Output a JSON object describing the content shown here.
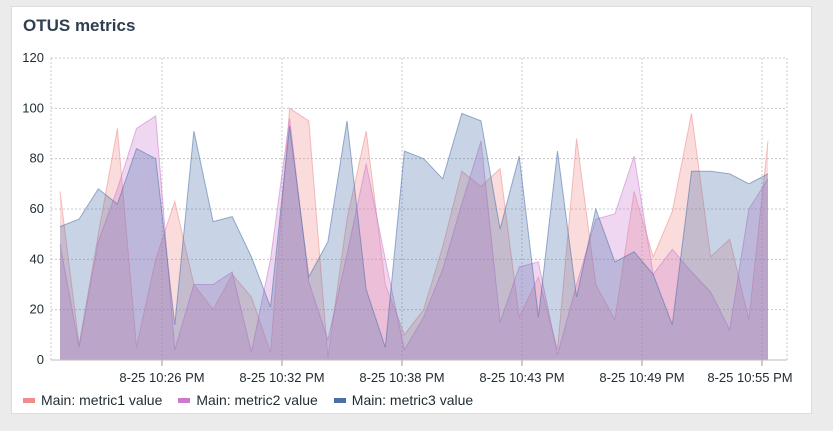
{
  "panel": {
    "title": "OTUS metrics"
  },
  "legend": [
    {
      "label": "Main: metric1 value",
      "color": "#f08c8c"
    },
    {
      "label": "Main: metric2 value",
      "color": "#cc7ad0"
    },
    {
      "label": "Main: metric3 value",
      "color": "#4a70aa"
    }
  ],
  "chart_data": {
    "type": "area",
    "title": "OTUS metrics",
    "xlabel": "",
    "ylabel": "",
    "ylim": [
      0,
      120
    ],
    "yticks": [
      0,
      20,
      40,
      60,
      80,
      100,
      120
    ],
    "x_tick_labels": [
      "8-25 10:26 PM",
      "8-25 10:32 PM",
      "8-25 10:38 PM",
      "8-25 10:43 PM",
      "8-25 10:49 PM",
      "8-25 10:55 PM"
    ],
    "grid": true,
    "legend_position": "bottom-left",
    "series": [
      {
        "name": "Main: metric1 value",
        "color": "#f08c8c",
        "values": [
          67,
          6,
          50,
          92,
          5,
          40,
          63,
          30,
          20,
          34,
          25,
          3,
          100,
          95,
          1,
          56,
          91,
          30,
          10,
          20,
          45,
          75,
          69,
          76,
          17,
          33,
          4,
          88,
          30,
          16,
          67,
          41,
          59,
          98,
          41,
          48,
          16,
          87
        ]
      },
      {
        "name": "Main: metric2 value",
        "color": "#cc7ad0",
        "values": [
          46,
          5,
          47,
          68,
          92,
          97,
          4,
          30,
          30,
          35,
          3,
          40,
          96,
          31,
          8,
          42,
          78,
          40,
          4,
          17,
          36,
          62,
          87,
          15,
          37,
          39,
          2,
          30,
          56,
          58,
          81,
          34,
          44,
          35,
          27,
          12,
          60,
          72
        ]
      },
      {
        "name": "Main: metric3 value",
        "color": "#4a70aa",
        "values": [
          53,
          56,
          68,
          62,
          84,
          80,
          14,
          91,
          55,
          57,
          41,
          21,
          93,
          33,
          47,
          95,
          28,
          5,
          83,
          80,
          72,
          98,
          95,
          52,
          81,
          17,
          83,
          25,
          60,
          39,
          43,
          34,
          14,
          75,
          75,
          74,
          70,
          74
        ]
      }
    ]
  }
}
